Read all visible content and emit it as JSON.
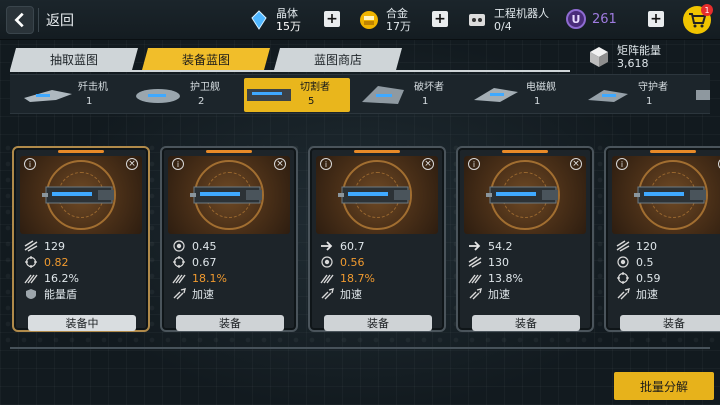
{
  "header": {
    "back_label": "返回",
    "resources": [
      {
        "name": "晶体",
        "value": "15万",
        "icon": "crystal-icon"
      },
      {
        "name": "合金",
        "value": "17万",
        "icon": "alloy-icon"
      },
      {
        "name": "工程机器人",
        "value": "0/4",
        "icon": "robot-icon"
      }
    ],
    "premium": {
      "symbol": "U",
      "value": "261"
    },
    "cart_badge": "1"
  },
  "tabs": [
    {
      "label": "抽取蓝图",
      "active": false
    },
    {
      "label": "装备蓝图",
      "active": true
    },
    {
      "label": "蓝图商店",
      "active": false
    }
  ],
  "matrix_energy": {
    "label": "矩阵能量",
    "value": "3,618"
  },
  "ships": [
    {
      "name": "歼击机",
      "count": "1"
    },
    {
      "name": "护卫舰",
      "count": "2"
    },
    {
      "name": "切割者",
      "count": "5",
      "active": true
    },
    {
      "name": "破坏者",
      "count": "1"
    },
    {
      "name": "电磁舰",
      "count": "1"
    },
    {
      "name": "守护者",
      "count": "1"
    }
  ],
  "cards": [
    {
      "stats": [
        {
          "icon": "firepower-icon",
          "value": "129",
          "orange": false
        },
        {
          "icon": "crosshair-icon",
          "value": "0.82",
          "orange": true
        },
        {
          "icon": "burst-icon",
          "value": "16.2%",
          "orange": false
        },
        {
          "icon": "shield-icon",
          "value": "能量盾",
          "orange": false
        }
      ],
      "button": "装备中",
      "equipped": true
    },
    {
      "stats": [
        {
          "icon": "target-icon",
          "value": "0.45",
          "orange": false
        },
        {
          "icon": "crosshair-icon",
          "value": "0.67",
          "orange": false
        },
        {
          "icon": "burst-icon",
          "value": "18.1%",
          "orange": true
        },
        {
          "icon": "boost-icon",
          "value": "加速",
          "orange": false
        }
      ],
      "button": "装备",
      "equipped": false
    },
    {
      "stats": [
        {
          "icon": "arrow-icon",
          "value": "60.7",
          "orange": false
        },
        {
          "icon": "target-icon",
          "value": "0.56",
          "orange": true
        },
        {
          "icon": "burst-icon",
          "value": "18.7%",
          "orange": true
        },
        {
          "icon": "boost-icon",
          "value": "加速",
          "orange": false
        }
      ],
      "button": "装备",
      "equipped": false
    },
    {
      "stats": [
        {
          "icon": "arrow-icon",
          "value": "54.2",
          "orange": false
        },
        {
          "icon": "firepower-icon",
          "value": "130",
          "orange": false
        },
        {
          "icon": "burst-icon",
          "value": "13.8%",
          "orange": false
        },
        {
          "icon": "boost-icon",
          "value": "加速",
          "orange": false
        }
      ],
      "button": "装备",
      "equipped": false
    },
    {
      "stats": [
        {
          "icon": "firepower-icon",
          "value": "120",
          "orange": false
        },
        {
          "icon": "target-icon",
          "value": "0.5",
          "orange": false
        },
        {
          "icon": "crosshair-icon",
          "value": "0.59",
          "orange": false
        },
        {
          "icon": "boost-icon",
          "value": "加速",
          "orange": false
        }
      ],
      "button": "装备",
      "equipped": false
    }
  ],
  "batch_button": "批量分解"
}
